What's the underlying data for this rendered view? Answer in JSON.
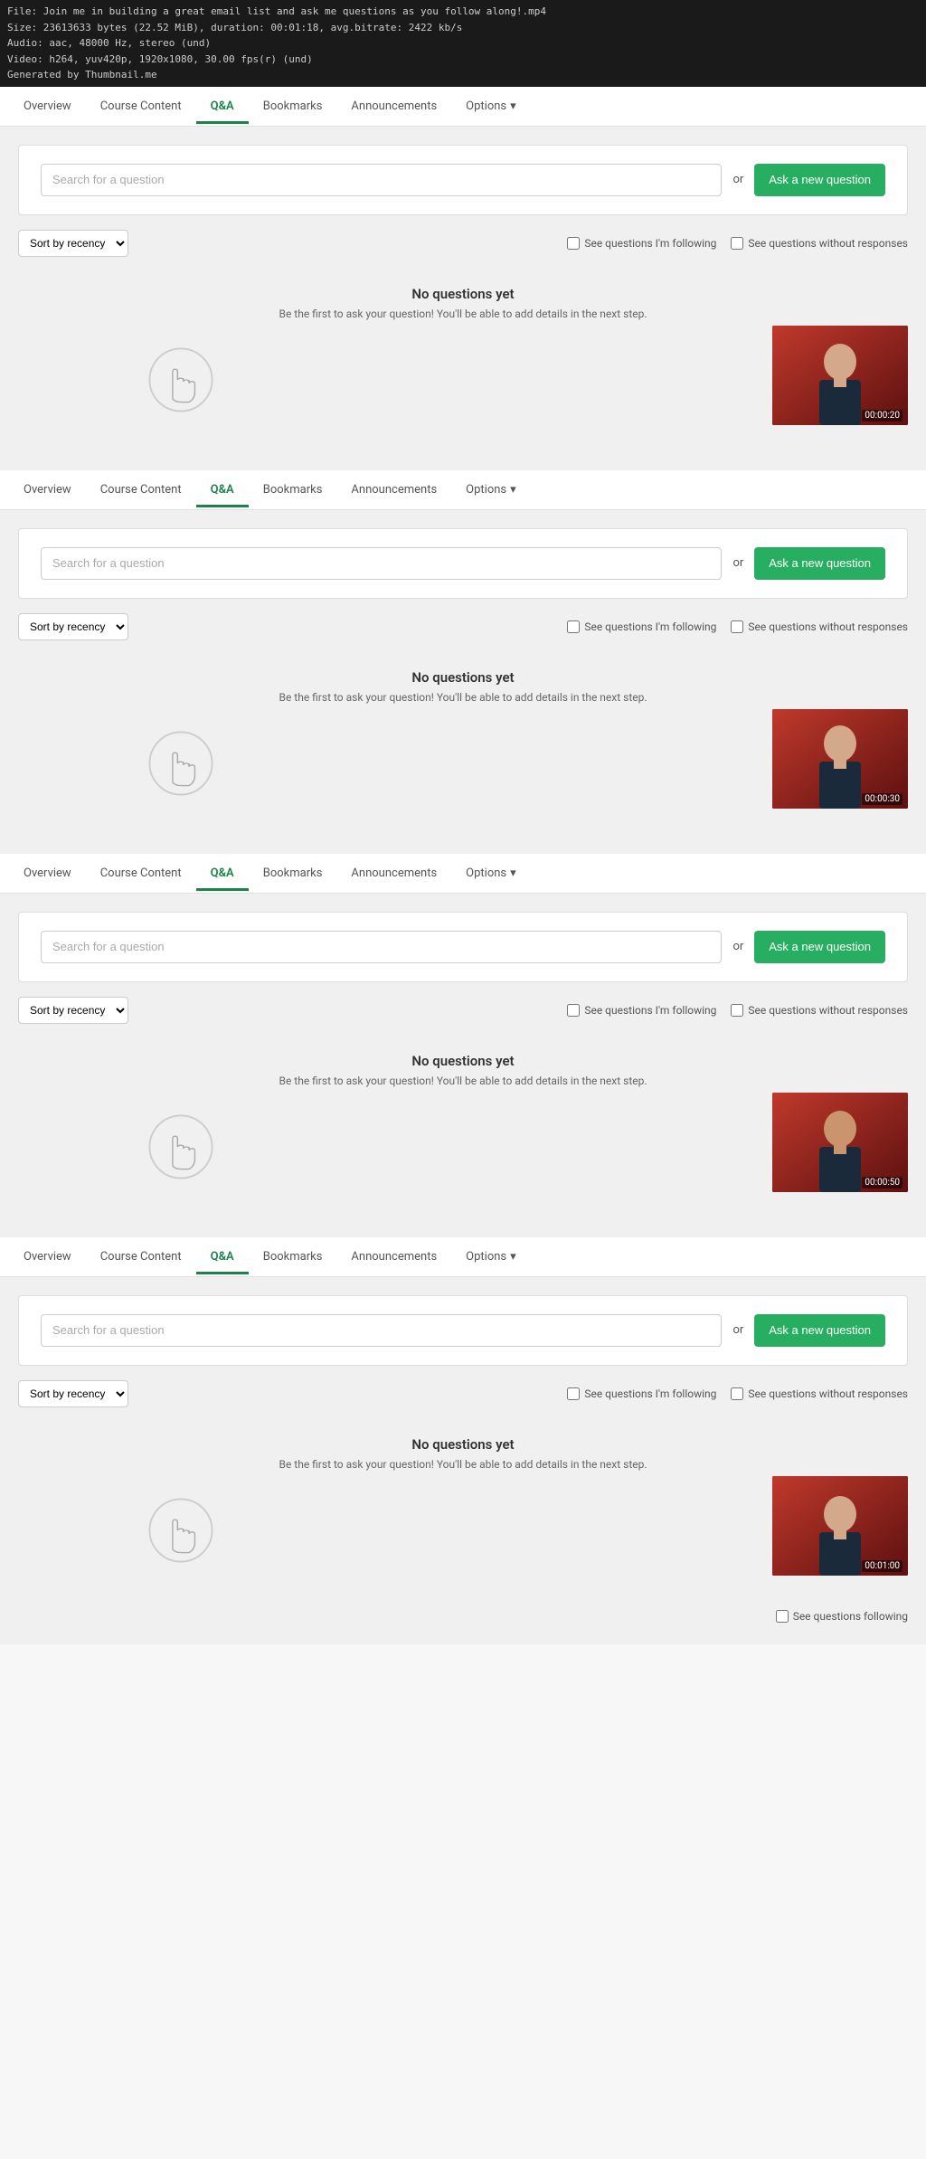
{
  "fileInfo": {
    "line1": "File: Join me in building a great email list and ask me questions as you follow along!.mp4",
    "line2": "Size: 23613633 bytes (22.52 MiB), duration: 00:01:18, avg.bitrate: 2422 kb/s",
    "line3": "Audio: aac, 48000 Hz, stereo (und)",
    "line4": "Video: h264, yuv420p, 1920x1080, 30.00 fps(r) (und)",
    "line5": "Generated by Thumbnail.me"
  },
  "nav": {
    "items": [
      {
        "label": "Overview",
        "active": false
      },
      {
        "label": "Course Content",
        "active": false
      },
      {
        "label": "Q&A",
        "active": true
      },
      {
        "label": "Bookmarks",
        "active": false
      },
      {
        "label": "Announcements",
        "active": false
      },
      {
        "label": "Options",
        "active": false,
        "dropdown": true
      }
    ]
  },
  "sections": [
    {
      "id": "section1",
      "search": {
        "placeholder": "Search for a question",
        "orLabel": "or",
        "askButtonLabel": "Ask a new question"
      },
      "filters": {
        "sortLabel": "Sort by recency",
        "followingLabel": "See questions I'm following",
        "noResponsesLabel": "See questions without responses"
      },
      "noQuestions": {
        "title": "No questions yet",
        "subtitle": "Be the first to ask your question! You'll be able to add details in the next step."
      },
      "videoTimer": "00:00:20"
    },
    {
      "id": "section2",
      "search": {
        "placeholder": "Search for a question",
        "orLabel": "or",
        "askButtonLabel": "Ask a new question"
      },
      "filters": {
        "sortLabel": "Sort by recency",
        "followingLabel": "See questions I'm following",
        "noResponsesLabel": "See questions without responses"
      },
      "noQuestions": {
        "title": "No questions yet",
        "subtitle": "Be the first to ask your question! You'll be able to add details in the next step."
      },
      "videoTimer": "00:00:30"
    },
    {
      "id": "section3",
      "search": {
        "placeholder": "Search for a question",
        "orLabel": "or",
        "askButtonLabel": "Ask a new question"
      },
      "filters": {
        "sortLabel": "Sort by recency",
        "followingLabel": "See questions I'm following",
        "noResponsesLabel": "See questions without responses"
      },
      "noQuestions": {
        "title": "No questions yet",
        "subtitle": "Be the first to ask your question! You'll be able to add details in the next step."
      },
      "videoTimer": "00:00:50"
    },
    {
      "id": "section4",
      "search": {
        "placeholder": "Search for a question",
        "orLabel": "or",
        "askButtonLabel": "Ask a new question"
      },
      "filters": {
        "sortLabel": "Sort by recency",
        "followingLabel": "See questions I'm following",
        "noResponsesLabel": "See questions without responses"
      },
      "noQuestions": {
        "title": "No questions yet",
        "subtitle": "Be the first to ask your question! You'll be able to add details in the next step."
      },
      "videoTimer": "00:01:00",
      "questionsFollowing": {
        "label": "See questions following",
        "checkbox": false
      }
    }
  ],
  "colors": {
    "activeTab": "#1d8348",
    "askButton": "#27ae60",
    "videoBackground": "#c0392b"
  }
}
